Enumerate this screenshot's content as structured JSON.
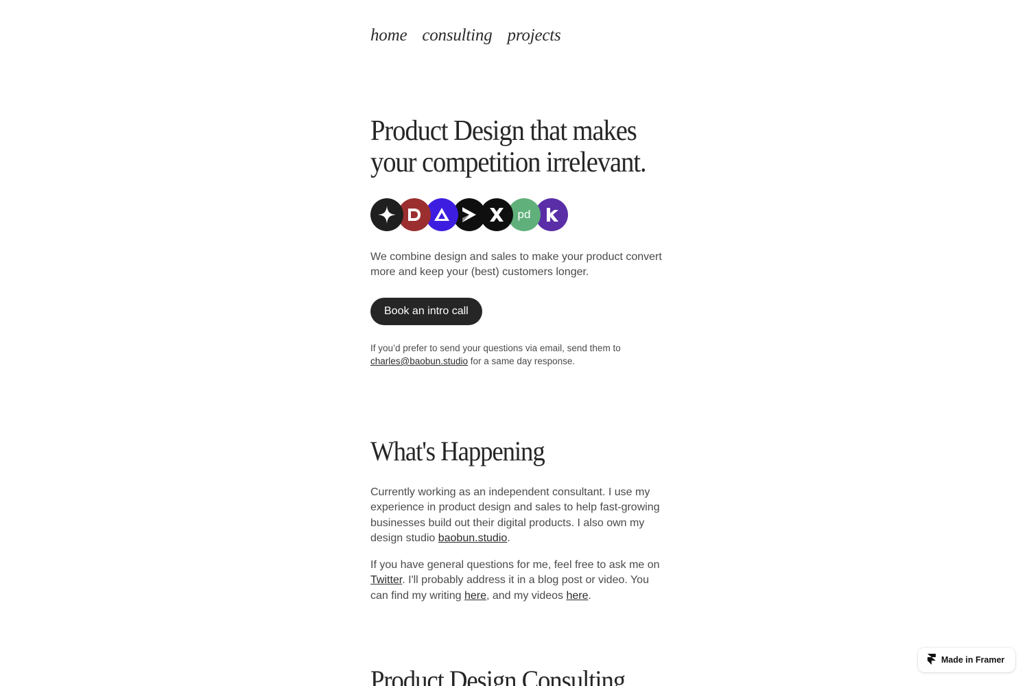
{
  "nav": {
    "items": [
      "home",
      "consulting",
      "projects"
    ]
  },
  "hero": {
    "title": "Product Design that makes your competition irrelevant.",
    "logos": [
      {
        "name": "sparkle-logo-icon",
        "bg": "#1f1f1f"
      },
      {
        "name": "d-logo-icon",
        "bg": "#9b2f2f"
      },
      {
        "name": "triangle-logo-icon",
        "bg": "#3d1ee0"
      },
      {
        "name": "chevron-logo-icon",
        "bg": "#0f0f0f"
      },
      {
        "name": "x-logo-icon",
        "bg": "#0f0f0f"
      },
      {
        "name": "pd-logo-icon",
        "bg": "#5fb07a"
      },
      {
        "name": "k-logo-icon",
        "bg": "#5a2ea6"
      }
    ],
    "lede": "We combine design and sales to make your product convert more and keep your (best) customers longer.",
    "cta_label": "Book an intro call",
    "note_prefix": "If you’d prefer to send your questions via email, send them to ",
    "note_email": "charles@baobun.studio",
    "note_suffix": " for a same day response."
  },
  "happening": {
    "title": "What's Happening",
    "p1_text": "Currently working as an independent consultant. I use my experience in product design and sales to help fast-growing businesses build out their digital products. I also own my design studio ",
    "p1_link": "baobun.studio",
    "p1_end": ".",
    "p2_a": "If you have general questions for me, feel free to ask me on ",
    "p2_twitter": "Twitter",
    "p2_b": ". I'll probably address it in a blog post or video. You can find my writing ",
    "p2_here1": "here",
    "p2_c": ", and my videos ",
    "p2_here2": "here",
    "p2_d": "."
  },
  "consulting": {
    "title": "Product Design Consulting"
  },
  "badge": {
    "label": "Made in Framer"
  },
  "colors": {
    "text": "#2b2b2b",
    "button_bg": "#262626",
    "background": "#ffffff"
  }
}
